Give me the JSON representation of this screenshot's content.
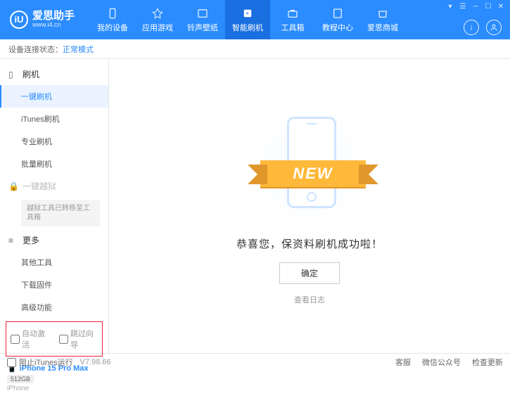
{
  "brand": {
    "name": "爱思助手",
    "url": "www.i4.cn",
    "logo_letter": "iU"
  },
  "nav": [
    {
      "label": "我的设备"
    },
    {
      "label": "应用游戏"
    },
    {
      "label": "铃声壁纸"
    },
    {
      "label": "智能刷机"
    },
    {
      "label": "工具箱"
    },
    {
      "label": "教程中心"
    },
    {
      "label": "爱思商城"
    }
  ],
  "status": {
    "label": "设备连接状态：",
    "value": "正常模式"
  },
  "sidebar": {
    "group_flash": "刷机",
    "items_flash": [
      "一键刷机",
      "iTunes刷机",
      "专业刷机",
      "批量刷机"
    ],
    "group_jailbreak": "一键越狱",
    "jailbreak_note": "越狱工具已转移至工具箱",
    "group_more": "更多",
    "items_more": [
      "其他工具",
      "下载固件",
      "高级功能"
    ],
    "cb_auto_activate": "自动激活",
    "cb_skip_guide": "跳过向导"
  },
  "device": {
    "name": "iPhone 15 Pro Max",
    "storage": "512GB",
    "type": "iPhone"
  },
  "main": {
    "ribbon": "NEW",
    "success": "恭喜您，保资料刷机成功啦！",
    "ok": "确定",
    "view_log": "查看日志"
  },
  "footer": {
    "block_itunes": "阻止iTunes运行",
    "version": "V7.98.66",
    "support": "客服",
    "wechat": "微信公众号",
    "check_update": "检查更新"
  }
}
